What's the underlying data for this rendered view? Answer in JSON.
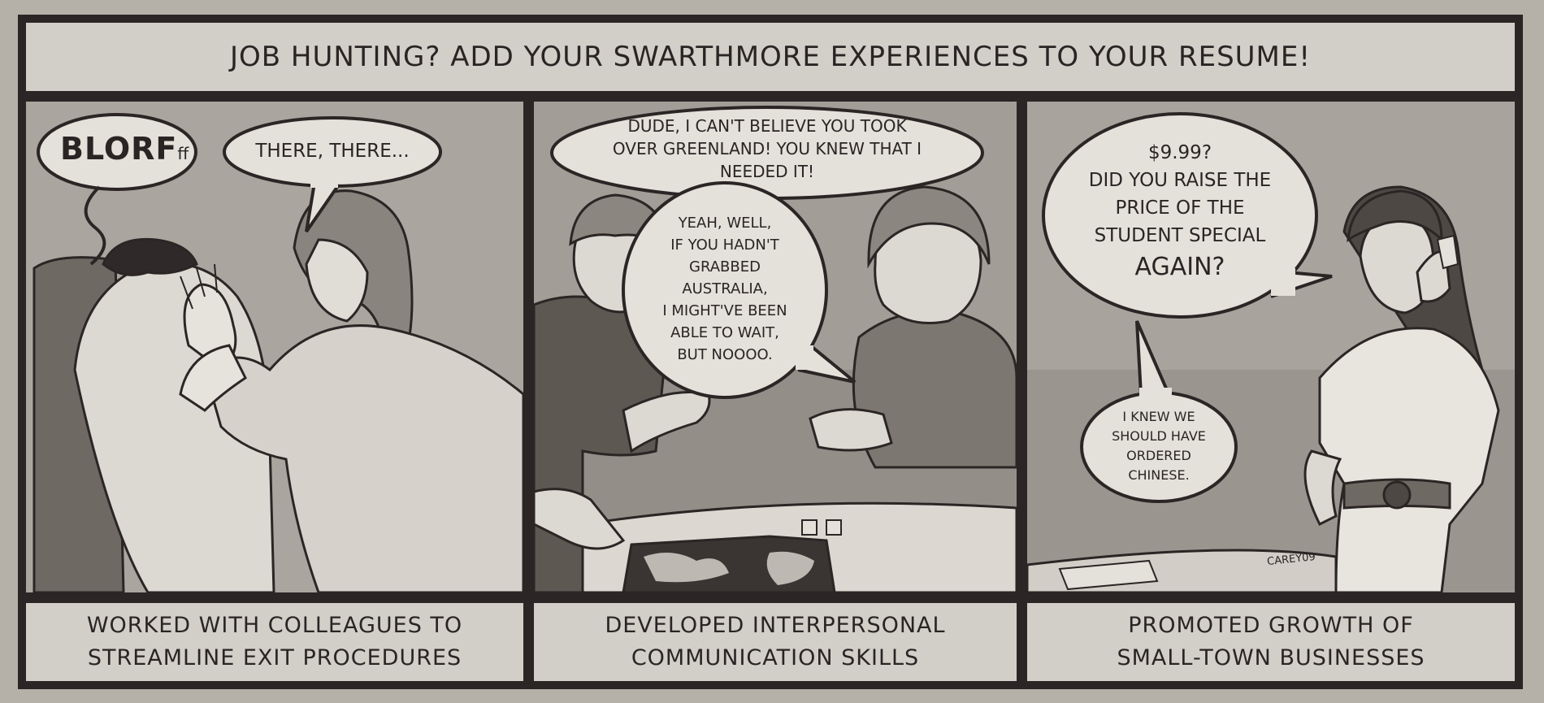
{
  "title": "JOB HUNTING? ADD YOUR SWARTHMORE EXPERIENCES TO YOUR RESUME!",
  "panels": [
    {
      "bubbles": {
        "sound": "BLORF",
        "sound_suffix": "ff",
        "speech": "THERE, THERE..."
      },
      "caption": [
        "WORKED WITH COLLEAGUES TO",
        "STREAMLINE EXIT PROCEDURES"
      ]
    },
    {
      "bubbles": {
        "top": [
          "DUDE, I CAN'T BELIEVE YOU TOOK",
          "OVER GREENLAND! YOU KNEW THAT I",
          "NEEDED IT!"
        ],
        "reply": [
          "YEAH, WELL,",
          "IF YOU HADN'T",
          "GRABBED",
          "AUSTRALIA,",
          "I MIGHT'VE BEEN",
          "ABLE TO WAIT,",
          "BUT NOOOO."
        ]
      },
      "caption": [
        "DEVELOPED INTERPERSONAL",
        "COMMUNICATION SKILLS"
      ]
    },
    {
      "bubbles": {
        "big": [
          "$9.99?",
          "DID YOU RAISE THE",
          "PRICE OF THE",
          "STUDENT SPECIAL",
          "AGAIN?"
        ],
        "small": [
          "I KNEW WE",
          "SHOULD HAVE",
          "ORDERED",
          "CHINESE."
        ]
      },
      "signature": "CAREY09",
      "caption": [
        "PROMOTED GROWTH OF",
        "SMALL-TOWN BUSINESSES"
      ]
    }
  ],
  "colors": {
    "border": "#2b2625",
    "panel_bg": "#a9a49d",
    "caption_bg": "#d2cfc8"
  }
}
